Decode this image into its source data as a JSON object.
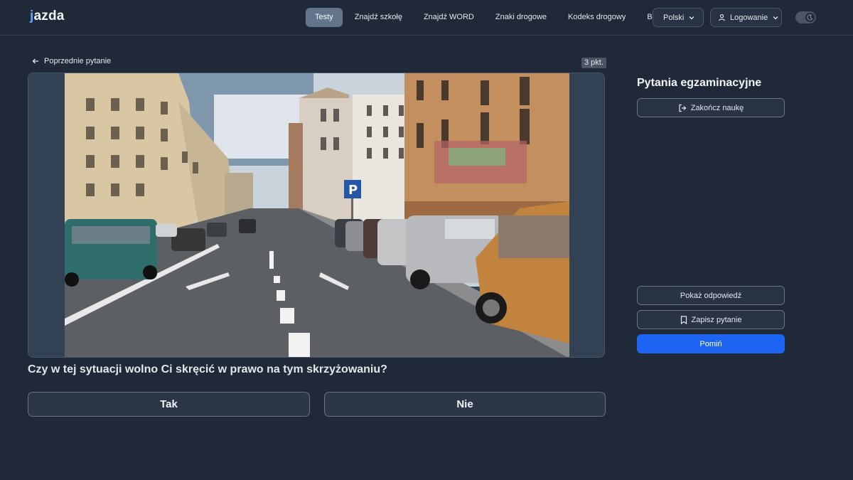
{
  "header": {
    "logo": "jazda",
    "nav": [
      {
        "label": "Testy",
        "active": true
      },
      {
        "label": "Znajdź szkołę",
        "active": false
      },
      {
        "label": "Znajdź WORD",
        "active": false
      },
      {
        "label": "Znaki drogowe",
        "active": false
      },
      {
        "label": "Kodeks drogowy",
        "active": false
      },
      {
        "label": "Blog",
        "active": false
      }
    ],
    "language": "Polski",
    "login": "Logowanie",
    "icons": {
      "language_chevron": "chevron-down-icon",
      "login_user": "user-icon",
      "login_chevron": "chevron-down-icon",
      "theme": "moon-icon"
    }
  },
  "question": {
    "prev_link": "Poprzednie pytanie",
    "points": "3 pkt.",
    "media_alt": "street-scene-photo",
    "text": "Czy w tej sytuacji wolno Ci skręcić w prawo na tym skrzyżowaniu?",
    "answers": [
      "Tak",
      "Nie"
    ]
  },
  "sidebar": {
    "title": "Pytania egzaminacyjne",
    "finish": "Zakończ naukę",
    "show_answer": "Pokaż odpowiedź",
    "save_question": "Zapisz pytanie",
    "skip": "Pomiń"
  },
  "colors": {
    "background": "#1f2937",
    "accent": "#1d64f2",
    "active_nav": "#64748b"
  }
}
